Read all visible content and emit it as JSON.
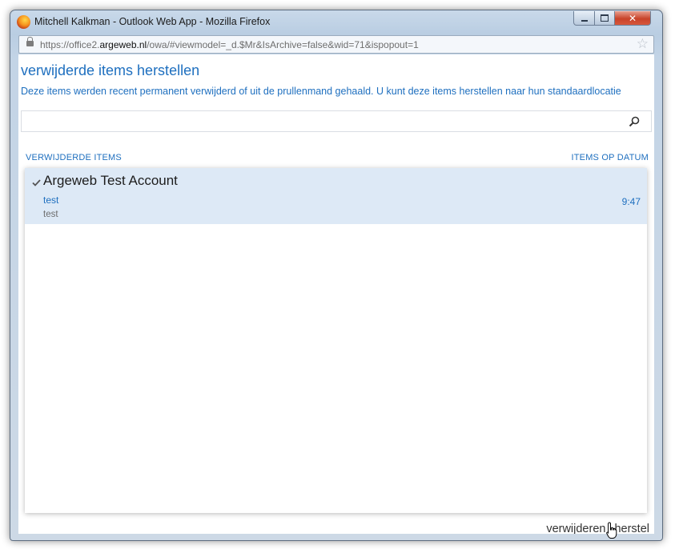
{
  "window": {
    "title": "Mitchell Kalkman - Outlook Web App - Mozilla Firefox",
    "controls": {
      "minimize": "minimize",
      "maximize": "maximize",
      "close": "✕"
    }
  },
  "urlbar": {
    "prefix": "https://office2.",
    "host": "argeweb.nl",
    "path": "/owa/#viewmodel=_d.$Mr&IsArchive=false&wid=71&ispopout=1"
  },
  "page": {
    "title": "verwijderde items herstellen",
    "description": "Deze items werden recent permanent verwijderd of uit de prullenmand gehaald. U kunt deze items herstellen naar hun standaardlocatie",
    "search": {
      "value": "",
      "placeholder": ""
    }
  },
  "list": {
    "header_left": "VERWIJDERDE ITEMS",
    "header_right": "ITEMS OP DATUM",
    "items": [
      {
        "sender": "Argeweb Test Account",
        "subject": "test",
        "preview": "test",
        "time": "9:47",
        "selected": true
      }
    ]
  },
  "actions": {
    "delete": "verwijderen",
    "restore": "herstel"
  },
  "colors": {
    "accent": "#1e6fbf",
    "selection": "#dde9f6"
  },
  "icons": [
    "firefox-icon",
    "lock-icon",
    "star-icon",
    "search-icon",
    "check-icon",
    "hand-cursor-icon"
  ]
}
